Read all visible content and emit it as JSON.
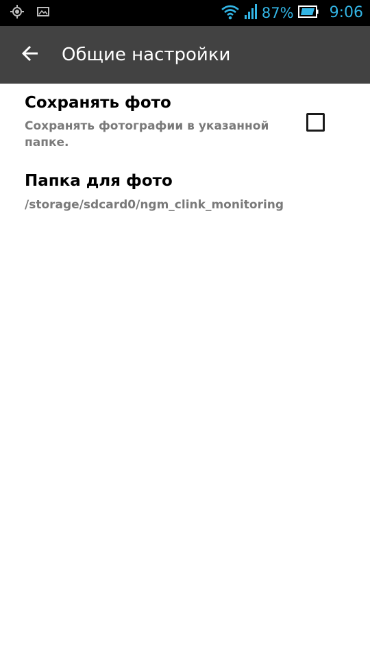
{
  "status_bar": {
    "battery_percent": "87%",
    "time": "9:06",
    "icons": [
      "gps-icon",
      "image-icon",
      "wifi-icon",
      "signal-icon",
      "battery-icon"
    ],
    "accent_color": "#33b5e5"
  },
  "app_bar": {
    "title": "Общие настройки",
    "background": "#424242"
  },
  "preferences": [
    {
      "title": "Сохранять фото",
      "summary": "Сохранять фотографии в указанной папке.",
      "checked": false
    },
    {
      "title": "Папка для фото",
      "summary": "/storage/sdcard0/ngm_clink_monitoring"
    }
  ]
}
